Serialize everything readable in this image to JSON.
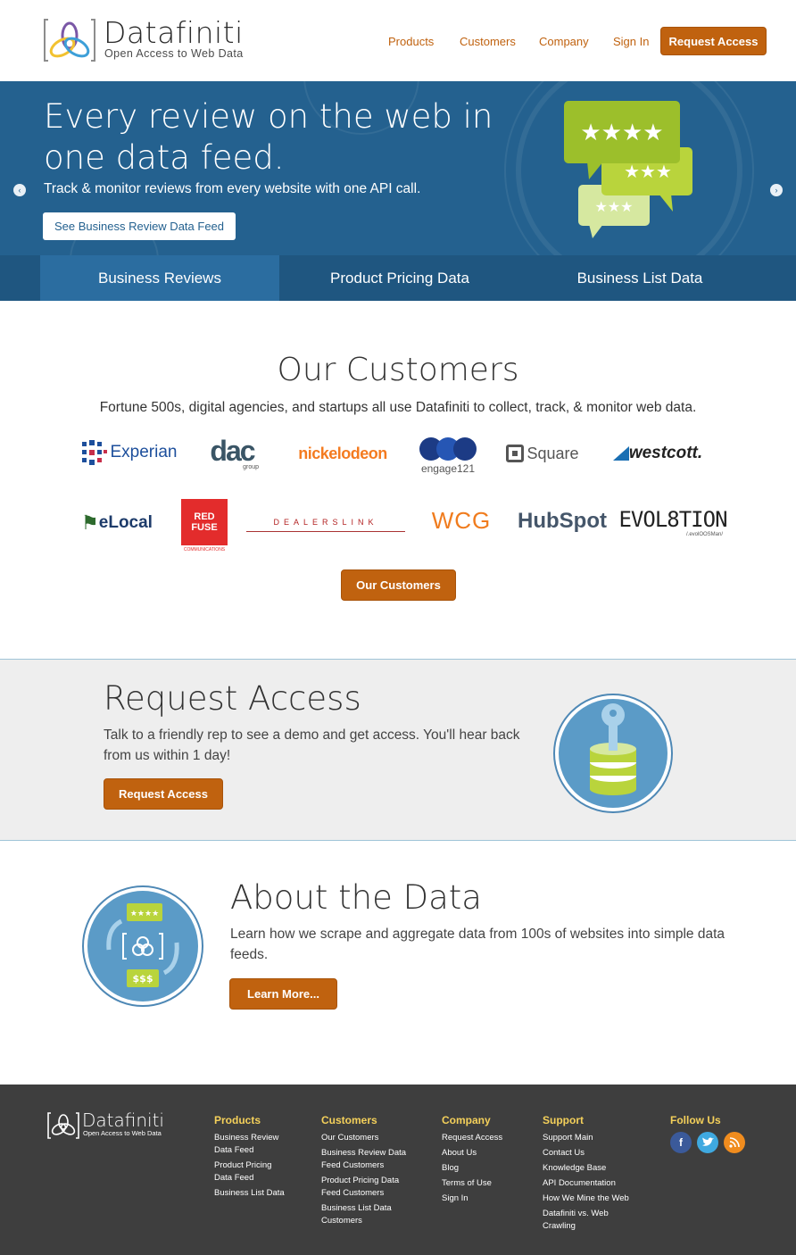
{
  "header": {
    "logo_word": "Datafiniti",
    "logo_tagline": "Open Access to Web Data",
    "nav": [
      "Products",
      "Customers",
      "Company",
      "Sign In"
    ],
    "cta": "Request Access"
  },
  "hero": {
    "title": "Every review on the web in one data feed.",
    "subtitle": "Track & monitor reviews from every website with one API call.",
    "button": "See Business Review Data Feed",
    "tabs": [
      "Business Reviews",
      "Product Pricing Data",
      "Business List Data"
    ],
    "active_tab": 0,
    "prev_arrow": "‹",
    "next_arrow": "›"
  },
  "customers": {
    "title": "Our Customers",
    "subtitle": "Fortune 500s, digital agencies, and startups all use Datafiniti to collect, track, & monitor web data.",
    "logos_row1": [
      "Experian",
      "dac",
      "nickelodeon",
      "engage121",
      "Square",
      "westcott."
    ],
    "logos_row2": [
      "eLocal",
      "RED FUSE",
      "DEALERSLINK",
      "WCG",
      "HubSpot",
      "EVOL8TION"
    ],
    "dac_sub": "group",
    "redfuse_sub": "COMMUNICATIONS",
    "evol_sub": "/.evolOOSMan/",
    "button": "Our Customers"
  },
  "request": {
    "title": "Request Access",
    "text": "Talk to a friendly rep to see a demo and get access. You'll hear back from us within 1 day!",
    "button": "Request Access"
  },
  "about": {
    "title": "About the Data",
    "text": "Learn how we scrape and aggregate data from 100s of websites into simple data feeds.",
    "button": "Learn More...",
    "badge_stars": "★★★★",
    "badge_money": "$$$"
  },
  "footer": {
    "logo_word": "Datafiniti",
    "logo_tagline": "Open Access to Web Data",
    "columns": [
      {
        "title": "Products",
        "links": [
          "Business Review Data Feed",
          "Product Pricing Data Feed",
          "Business List Data"
        ]
      },
      {
        "title": "Customers",
        "links": [
          "Our Customers",
          "Business Review Data Feed Customers",
          "Product Pricing Data Feed Customers",
          "Business List Data Customers"
        ]
      },
      {
        "title": "Company",
        "links": [
          "Request Access",
          "About Us",
          "Blog",
          "Terms of Use",
          "Sign In"
        ]
      },
      {
        "title": "Support",
        "links": [
          "Support Main",
          "Contact Us",
          "Knowledge Base",
          "API Documentation",
          "How We Mine the Web",
          "Datafiniti vs. Web Crawling"
        ]
      }
    ],
    "follow": "Follow Us",
    "social": [
      "facebook-icon",
      "twitter-icon",
      "rss-icon"
    ]
  },
  "colors": {
    "brand_orange": "#c0620f",
    "hero_blue": "#24618f",
    "hero_tab_bar": "#1f5680",
    "hero_tab_active": "#2b6da0",
    "footer_bg": "#3e3e3e",
    "footer_heading": "#f4d05a",
    "band_bg": "#eeeeee"
  }
}
